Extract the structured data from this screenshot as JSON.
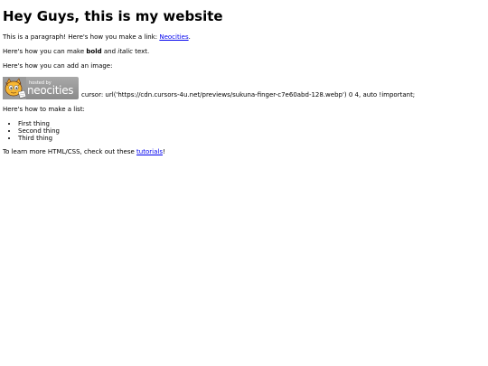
{
  "heading": "Hey Guys, this is my website",
  "paragraph1": {
    "before": "This is a paragraph! Here's how you make a link: ",
    "link": "Neocities",
    "after": "."
  },
  "paragraph2": {
    "before": "Here's how you can make ",
    "bold": "bold",
    "middle": " and ",
    "italic": "italic",
    "after": " text."
  },
  "paragraph3": "Here's how you can add an image:",
  "badge": {
    "hosted_by": "hosted by",
    "brand": "neocities"
  },
  "image_caption": "cursor: url('https://cdn.cursors-4u.net/previews/sukuna-finger-c7e60abd-128.webp') 0 4, auto !important;",
  "paragraph4": "Here's how to make a list:",
  "list": [
    "First thing",
    "Second thing",
    "Third thing"
  ],
  "paragraph5": {
    "before": "To learn more HTML/CSS, check out these ",
    "link": "tutorials",
    "after": "!"
  },
  "colors": {
    "link": "#0000ee",
    "badge_bg": "#999999"
  }
}
